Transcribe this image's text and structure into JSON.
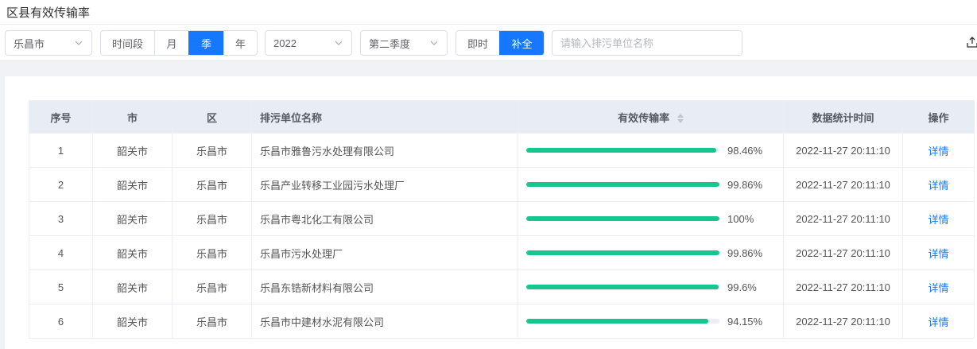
{
  "page": {
    "title": "区县有效传输率"
  },
  "filters": {
    "city": "乐昌市",
    "period_options": [
      "时间段",
      "月",
      "季",
      "年"
    ],
    "period_selected": "季",
    "year": "2022",
    "quarter": "第二季度",
    "mode_options": [
      "即时",
      "补全"
    ],
    "mode_selected": "补全",
    "search_placeholder": "请输入排污单位名称"
  },
  "table": {
    "headers": {
      "index": "序号",
      "city": "市",
      "district": "区",
      "unit": "排污单位名称",
      "rate": "有效传输率",
      "time": "数据统计时间",
      "action": "操作"
    },
    "rows": [
      {
        "index": "1",
        "city": "韶关市",
        "district": "乐昌市",
        "unit": "乐昌市雅鲁污水处理有限公司",
        "rate": 98.46,
        "rate_label": "98.46%",
        "time": "2022-11-27 20:11:10",
        "action": "详情"
      },
      {
        "index": "2",
        "city": "韶关市",
        "district": "乐昌市",
        "unit": "乐昌产业转移工业园污水处理厂",
        "rate": 99.86,
        "rate_label": "99.86%",
        "time": "2022-11-27 20:11:10",
        "action": "详情"
      },
      {
        "index": "3",
        "city": "韶关市",
        "district": "乐昌市",
        "unit": "乐昌市粤北化工有限公司",
        "rate": 100,
        "rate_label": "100%",
        "time": "2022-11-27 20:11:10",
        "action": "详情"
      },
      {
        "index": "4",
        "city": "韶关市",
        "district": "乐昌市",
        "unit": "乐昌市污水处理厂",
        "rate": 99.86,
        "rate_label": "99.86%",
        "time": "2022-11-27 20:11:10",
        "action": "详情"
      },
      {
        "index": "5",
        "city": "韶关市",
        "district": "乐昌市",
        "unit": "乐昌东锆新材料有限公司",
        "rate": 99.6,
        "rate_label": "99.6%",
        "time": "2022-11-27 20:11:10",
        "action": "详情"
      },
      {
        "index": "6",
        "city": "韶关市",
        "district": "乐昌市",
        "unit": "乐昌市中建材水泥有限公司",
        "rate": 94.15,
        "rate_label": "94.15%",
        "time": "2022-11-27 20:11:10",
        "action": "详情"
      }
    ]
  },
  "colors": {
    "accent": "#1677ff",
    "bar": "#16c68f",
    "bar_track": "#ebeef5",
    "header_bg": "#e8ecf4"
  },
  "icons": {
    "select": "chevron-down-icon",
    "sort": "sort-icon",
    "export": "export-icon"
  }
}
